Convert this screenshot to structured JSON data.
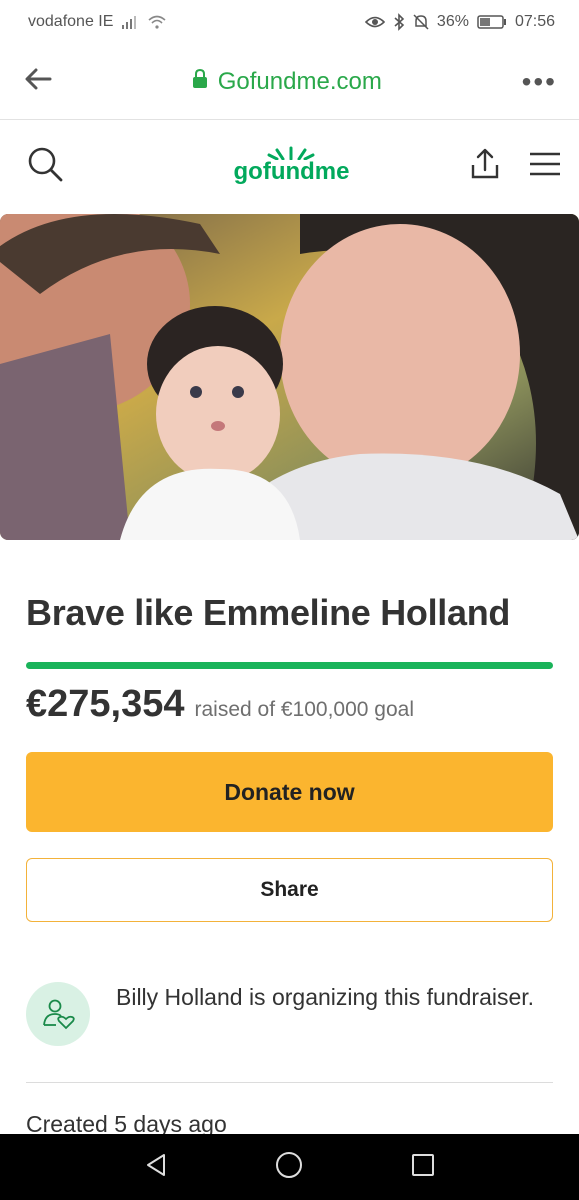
{
  "status_bar": {
    "carrier": "vodafone IE",
    "battery": "36%",
    "time": "07:56"
  },
  "browser": {
    "url": "Gofundme.com",
    "back_icon": "arrow-left-icon",
    "menu_icon": "more-dots-icon",
    "menu_label": "•••"
  },
  "site_header": {
    "logo_text": "gofundme",
    "search_icon": "search-icon",
    "share_icon": "share-upload-icon",
    "menu_icon": "hamburger-menu-icon"
  },
  "campaign": {
    "title": "Brave like Emmeline Holland",
    "raised_amount": "€275,354",
    "raised_text": "raised of €100,000 goal",
    "progress_fraction": 1.0,
    "donate_label": "Donate now",
    "share_label": "Share",
    "organizer_text": "Billy Holland is organizing this fundraiser.",
    "created_text": "Created 5 days ago"
  },
  "colors": {
    "brand_green": "#02a95c",
    "url_green": "#2aa84a",
    "donate_yellow": "#fbb52f",
    "progress_green": "#1ab35a"
  }
}
